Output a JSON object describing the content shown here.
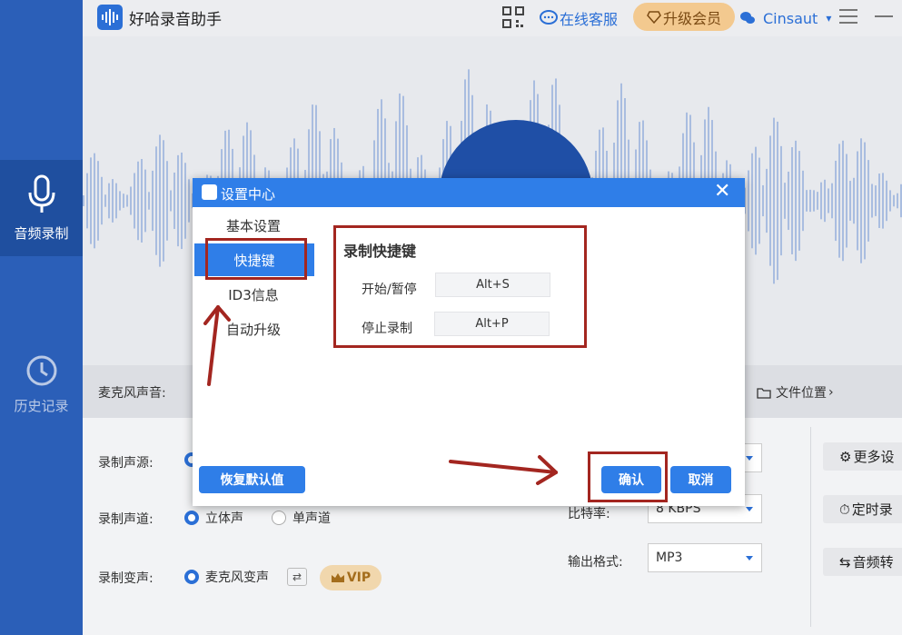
{
  "app": {
    "title": "好哈录音助手"
  },
  "topbar": {
    "service": "在线客服",
    "vip": "升级会员",
    "user": "Cinsaut",
    "user_caret": "▾"
  },
  "sidebar": {
    "items": [
      {
        "label": "音频录制"
      },
      {
        "label": "历史记录"
      }
    ]
  },
  "midbar": {
    "mic_label": "麦克风声音:",
    "file_location": "文件位置"
  },
  "settings": {
    "source_label": "录制声源:",
    "channel_label": "录制声道:",
    "channel_options": [
      "立体声",
      "单声道"
    ],
    "voice_label": "录制变声:",
    "voice_option": "麦克风变声",
    "vip_tag": "VIP",
    "bitrate_label": "比特率:",
    "bitrate_value": "8 KBPS",
    "format_label": "输出格式:",
    "format_value": "MP3",
    "more_settings": "更多设",
    "timer": "定时录",
    "convert": "音频转"
  },
  "dialog": {
    "title": "设置中心",
    "close": "✕",
    "nav": [
      "基本设置",
      "快捷键",
      "ID3信息",
      "自动升级"
    ],
    "section_title": "录制快捷键",
    "start_label": "开始/暂停",
    "start_value": "Alt+S",
    "stop_label": "停止录制",
    "stop_value": "Alt+P",
    "reset_button": "恢复默认值",
    "ok_button": "确认",
    "cancel_button": "取消"
  },
  "colors": {
    "sidebar": "#2b5fb8",
    "accent": "#2f7ee8",
    "annotation": "#a32620"
  }
}
